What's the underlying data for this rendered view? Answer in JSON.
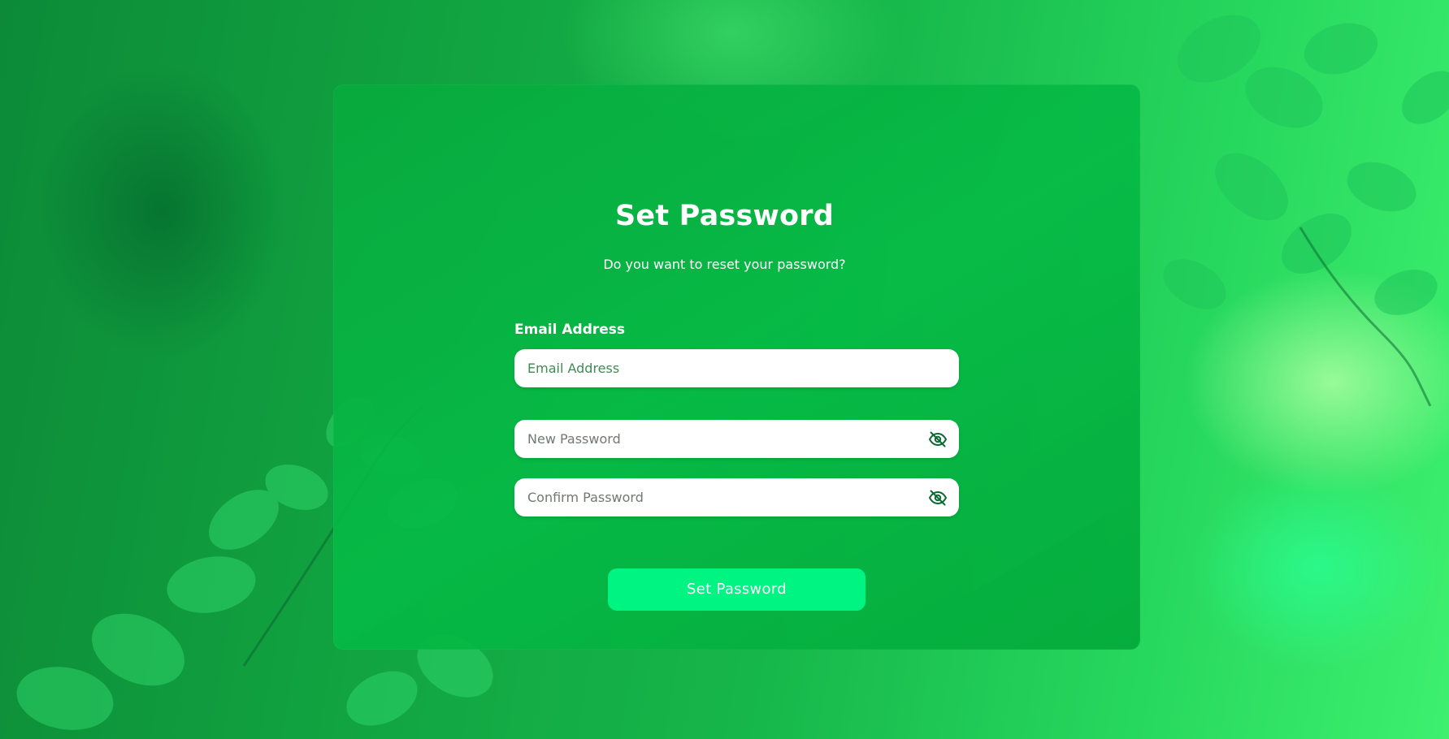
{
  "colors": {
    "background": "#16b64a",
    "card": "#07b045",
    "button": "#00f482",
    "input_bg": "#ffffff",
    "email_placeholder": "#3f8a55",
    "password_placeholder": "#707a72",
    "icon": "#0d6b33"
  },
  "form": {
    "title": "Set Password",
    "subtitle": "Do you want to reset your password?",
    "email_label": "Email Address",
    "email_placeholder": "Email Address",
    "new_password_placeholder": "New Password",
    "confirm_password_placeholder": "Confirm Password",
    "submit_label": "Set Password"
  },
  "icons": {
    "new_password_toggle": "eye-slash-icon",
    "confirm_password_toggle": "eye-slash-icon"
  }
}
